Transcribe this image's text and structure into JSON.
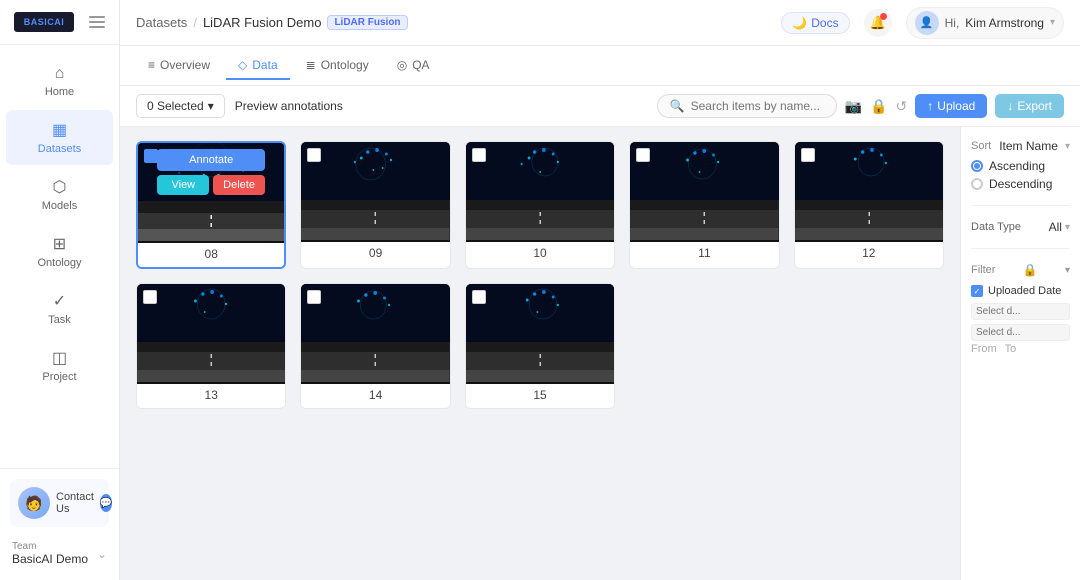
{
  "app": {
    "logo": "BASIC",
    "logo_accent": "AI"
  },
  "header": {
    "breadcrumb": {
      "root": "Datasets",
      "separator": "/",
      "current": "LiDAR Fusion Demo"
    },
    "badge": "LiDAR Fusion",
    "docs_label": "Docs",
    "user": {
      "greeting": "Hi,",
      "name": "Kim Armstrong"
    },
    "notifications": "notifications"
  },
  "tabs": [
    {
      "id": "overview",
      "label": "Overview",
      "icon": "≡",
      "active": false
    },
    {
      "id": "data",
      "label": "Data",
      "icon": "◇",
      "active": true
    },
    {
      "id": "ontology",
      "label": "Ontology",
      "icon": "≣",
      "active": false
    },
    {
      "id": "qa",
      "label": "QA",
      "icon": "◎",
      "active": false
    }
  ],
  "toolbar": {
    "selected_label": "0 Selected",
    "preview_label": "Preview annotations",
    "search_placeholder": "Search items by name...",
    "upload_label": "Upload",
    "export_label": "Export"
  },
  "grid": {
    "items": [
      {
        "id": "08",
        "label": "08",
        "selected": true,
        "hovered": true
      },
      {
        "id": "09",
        "label": "09",
        "selected": false,
        "hovered": false
      },
      {
        "id": "10",
        "label": "10",
        "selected": false,
        "hovered": false
      },
      {
        "id": "11",
        "label": "11",
        "selected": false,
        "hovered": false
      },
      {
        "id": "12",
        "label": "12",
        "selected": false,
        "hovered": false
      },
      {
        "id": "13",
        "label": "13",
        "selected": false,
        "hovered": false
      },
      {
        "id": "14",
        "label": "14",
        "selected": false,
        "hovered": false
      },
      {
        "id": "15",
        "label": "15",
        "selected": false,
        "hovered": false
      }
    ],
    "actions": {
      "annotate": "Annotate",
      "view": "View",
      "delete": "Delete"
    }
  },
  "sort": {
    "label": "Sort",
    "field_label": "Item Name",
    "options": [
      {
        "id": "ascending",
        "label": "Ascending",
        "selected": true
      },
      {
        "id": "descending",
        "label": "Descending",
        "selected": false
      }
    ]
  },
  "filter": {
    "label": "Filter",
    "data_type_label": "Data Type",
    "data_type_value": "All",
    "uploaded_date_label": "Uploaded Date",
    "from_label": "From",
    "to_label": "To",
    "select_placeholder": "Select d..."
  },
  "sidebar": {
    "items": [
      {
        "id": "home",
        "label": "Home",
        "icon": "⌂"
      },
      {
        "id": "datasets",
        "label": "Datasets",
        "icon": "▦",
        "active": true
      },
      {
        "id": "models",
        "label": "Models",
        "icon": "⬡"
      },
      {
        "id": "ontology",
        "label": "Ontology",
        "icon": "⊞"
      },
      {
        "id": "task",
        "label": "Task",
        "icon": "✓"
      },
      {
        "id": "project",
        "label": "Project",
        "icon": "◫"
      }
    ],
    "contact": {
      "label": "Contact Us",
      "icon": "🧑"
    },
    "team_label": "Team",
    "team_name": "BasicAI Demo"
  }
}
